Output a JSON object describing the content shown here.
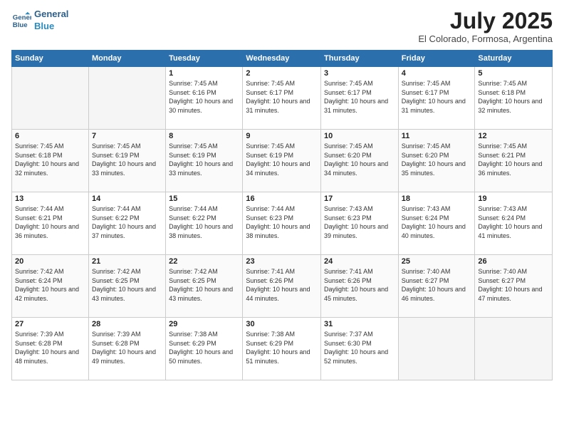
{
  "header": {
    "logo_line1": "General",
    "logo_line2": "Blue",
    "month": "July 2025",
    "location": "El Colorado, Formosa, Argentina"
  },
  "weekdays": [
    "Sunday",
    "Monday",
    "Tuesday",
    "Wednesday",
    "Thursday",
    "Friday",
    "Saturday"
  ],
  "weeks": [
    [
      {
        "day": "",
        "sunrise": "",
        "sunset": "",
        "daylight": ""
      },
      {
        "day": "",
        "sunrise": "",
        "sunset": "",
        "daylight": ""
      },
      {
        "day": "1",
        "sunrise": "Sunrise: 7:45 AM",
        "sunset": "Sunset: 6:16 PM",
        "daylight": "Daylight: 10 hours and 30 minutes."
      },
      {
        "day": "2",
        "sunrise": "Sunrise: 7:45 AM",
        "sunset": "Sunset: 6:17 PM",
        "daylight": "Daylight: 10 hours and 31 minutes."
      },
      {
        "day": "3",
        "sunrise": "Sunrise: 7:45 AM",
        "sunset": "Sunset: 6:17 PM",
        "daylight": "Daylight: 10 hours and 31 minutes."
      },
      {
        "day": "4",
        "sunrise": "Sunrise: 7:45 AM",
        "sunset": "Sunset: 6:17 PM",
        "daylight": "Daylight: 10 hours and 31 minutes."
      },
      {
        "day": "5",
        "sunrise": "Sunrise: 7:45 AM",
        "sunset": "Sunset: 6:18 PM",
        "daylight": "Daylight: 10 hours and 32 minutes."
      }
    ],
    [
      {
        "day": "6",
        "sunrise": "Sunrise: 7:45 AM",
        "sunset": "Sunset: 6:18 PM",
        "daylight": "Daylight: 10 hours and 32 minutes."
      },
      {
        "day": "7",
        "sunrise": "Sunrise: 7:45 AM",
        "sunset": "Sunset: 6:19 PM",
        "daylight": "Daylight: 10 hours and 33 minutes."
      },
      {
        "day": "8",
        "sunrise": "Sunrise: 7:45 AM",
        "sunset": "Sunset: 6:19 PM",
        "daylight": "Daylight: 10 hours and 33 minutes."
      },
      {
        "day": "9",
        "sunrise": "Sunrise: 7:45 AM",
        "sunset": "Sunset: 6:19 PM",
        "daylight": "Daylight: 10 hours and 34 minutes."
      },
      {
        "day": "10",
        "sunrise": "Sunrise: 7:45 AM",
        "sunset": "Sunset: 6:20 PM",
        "daylight": "Daylight: 10 hours and 34 minutes."
      },
      {
        "day": "11",
        "sunrise": "Sunrise: 7:45 AM",
        "sunset": "Sunset: 6:20 PM",
        "daylight": "Daylight: 10 hours and 35 minutes."
      },
      {
        "day": "12",
        "sunrise": "Sunrise: 7:45 AM",
        "sunset": "Sunset: 6:21 PM",
        "daylight": "Daylight: 10 hours and 36 minutes."
      }
    ],
    [
      {
        "day": "13",
        "sunrise": "Sunrise: 7:44 AM",
        "sunset": "Sunset: 6:21 PM",
        "daylight": "Daylight: 10 hours and 36 minutes."
      },
      {
        "day": "14",
        "sunrise": "Sunrise: 7:44 AM",
        "sunset": "Sunset: 6:22 PM",
        "daylight": "Daylight: 10 hours and 37 minutes."
      },
      {
        "day": "15",
        "sunrise": "Sunrise: 7:44 AM",
        "sunset": "Sunset: 6:22 PM",
        "daylight": "Daylight: 10 hours and 38 minutes."
      },
      {
        "day": "16",
        "sunrise": "Sunrise: 7:44 AM",
        "sunset": "Sunset: 6:23 PM",
        "daylight": "Daylight: 10 hours and 38 minutes."
      },
      {
        "day": "17",
        "sunrise": "Sunrise: 7:43 AM",
        "sunset": "Sunset: 6:23 PM",
        "daylight": "Daylight: 10 hours and 39 minutes."
      },
      {
        "day": "18",
        "sunrise": "Sunrise: 7:43 AM",
        "sunset": "Sunset: 6:24 PM",
        "daylight": "Daylight: 10 hours and 40 minutes."
      },
      {
        "day": "19",
        "sunrise": "Sunrise: 7:43 AM",
        "sunset": "Sunset: 6:24 PM",
        "daylight": "Daylight: 10 hours and 41 minutes."
      }
    ],
    [
      {
        "day": "20",
        "sunrise": "Sunrise: 7:42 AM",
        "sunset": "Sunset: 6:24 PM",
        "daylight": "Daylight: 10 hours and 42 minutes."
      },
      {
        "day": "21",
        "sunrise": "Sunrise: 7:42 AM",
        "sunset": "Sunset: 6:25 PM",
        "daylight": "Daylight: 10 hours and 43 minutes."
      },
      {
        "day": "22",
        "sunrise": "Sunrise: 7:42 AM",
        "sunset": "Sunset: 6:25 PM",
        "daylight": "Daylight: 10 hours and 43 minutes."
      },
      {
        "day": "23",
        "sunrise": "Sunrise: 7:41 AM",
        "sunset": "Sunset: 6:26 PM",
        "daylight": "Daylight: 10 hours and 44 minutes."
      },
      {
        "day": "24",
        "sunrise": "Sunrise: 7:41 AM",
        "sunset": "Sunset: 6:26 PM",
        "daylight": "Daylight: 10 hours and 45 minutes."
      },
      {
        "day": "25",
        "sunrise": "Sunrise: 7:40 AM",
        "sunset": "Sunset: 6:27 PM",
        "daylight": "Daylight: 10 hours and 46 minutes."
      },
      {
        "day": "26",
        "sunrise": "Sunrise: 7:40 AM",
        "sunset": "Sunset: 6:27 PM",
        "daylight": "Daylight: 10 hours and 47 minutes."
      }
    ],
    [
      {
        "day": "27",
        "sunrise": "Sunrise: 7:39 AM",
        "sunset": "Sunset: 6:28 PM",
        "daylight": "Daylight: 10 hours and 48 minutes."
      },
      {
        "day": "28",
        "sunrise": "Sunrise: 7:39 AM",
        "sunset": "Sunset: 6:28 PM",
        "daylight": "Daylight: 10 hours and 49 minutes."
      },
      {
        "day": "29",
        "sunrise": "Sunrise: 7:38 AM",
        "sunset": "Sunset: 6:29 PM",
        "daylight": "Daylight: 10 hours and 50 minutes."
      },
      {
        "day": "30",
        "sunrise": "Sunrise: 7:38 AM",
        "sunset": "Sunset: 6:29 PM",
        "daylight": "Daylight: 10 hours and 51 minutes."
      },
      {
        "day": "31",
        "sunrise": "Sunrise: 7:37 AM",
        "sunset": "Sunset: 6:30 PM",
        "daylight": "Daylight: 10 hours and 52 minutes."
      },
      {
        "day": "",
        "sunrise": "",
        "sunset": "",
        "daylight": ""
      },
      {
        "day": "",
        "sunrise": "",
        "sunset": "",
        "daylight": ""
      }
    ]
  ]
}
